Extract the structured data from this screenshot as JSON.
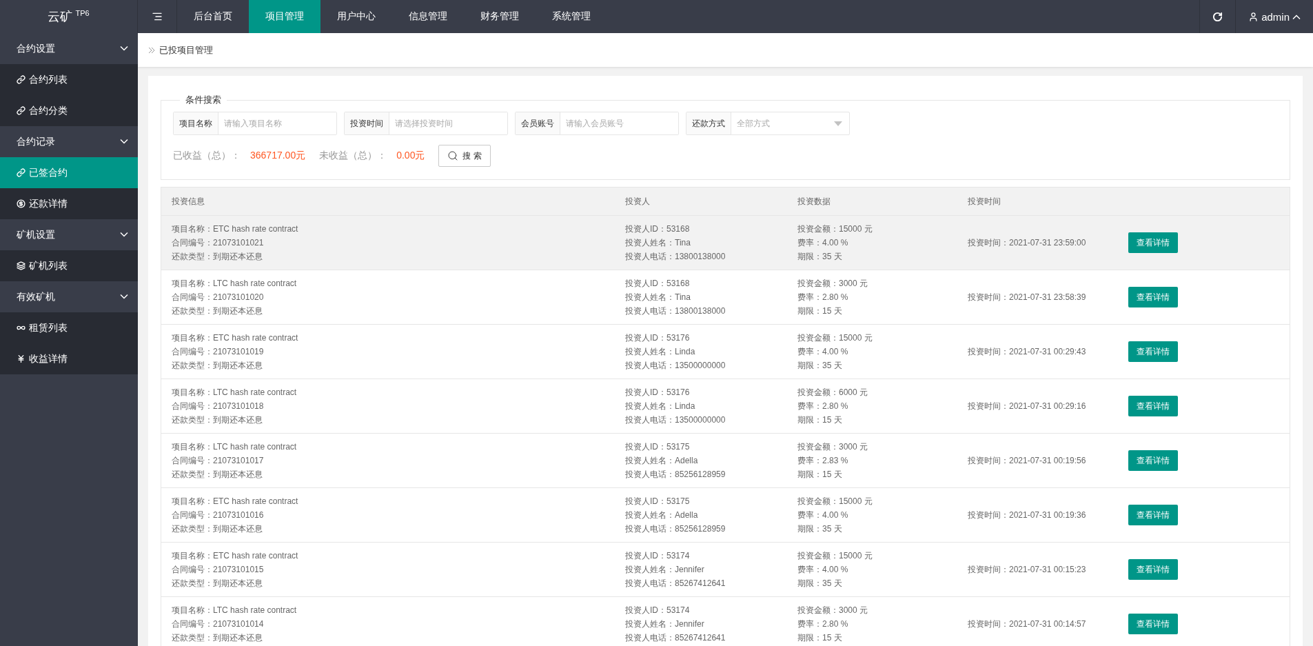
{
  "logo": {
    "name": "云矿",
    "sup": "TP6"
  },
  "nav": [
    {
      "label": "后台首页",
      "selected": false
    },
    {
      "label": "项目管理",
      "selected": true
    },
    {
      "label": "用户中心",
      "selected": false
    },
    {
      "label": "信息管理",
      "selected": false
    },
    {
      "label": "财务管理",
      "selected": false
    },
    {
      "label": "系统管理",
      "selected": false
    }
  ],
  "user": {
    "name": "admin"
  },
  "sidebar": [
    {
      "label": "合约设置",
      "expanded": true,
      "children": [
        {
          "label": "合约列表",
          "selected": false
        },
        {
          "label": "合约分类",
          "selected": false
        }
      ]
    },
    {
      "label": "合约记录",
      "expanded": true,
      "children": [
        {
          "label": "已签合约",
          "selected": true
        },
        {
          "label": "还款详情",
          "selected": false
        }
      ]
    },
    {
      "label": "矿机设置",
      "expanded": true,
      "children": [
        {
          "label": "矿机列表",
          "selected": false
        }
      ]
    },
    {
      "label": "有效矿机",
      "expanded": true,
      "children": [
        {
          "label": "租赁列表",
          "selected": false
        },
        {
          "label": "收益详情",
          "selected": false
        }
      ]
    }
  ],
  "breadcrumb": "已投项目管理",
  "search": {
    "legend": "条件搜索",
    "fields": [
      {
        "label": "项目名称",
        "placeholder": "请输入项目名称",
        "kind": "input"
      },
      {
        "label": "投资时间",
        "placeholder": "请选择投资时间",
        "kind": "input"
      },
      {
        "label": "会员账号",
        "placeholder": "请输入会员账号",
        "kind": "input"
      },
      {
        "label": "还款方式",
        "value": "全部方式",
        "kind": "select"
      }
    ],
    "totals": [
      {
        "label": "已收益（总）：",
        "value": "366717.00元"
      },
      {
        "label": "未收益（总）：",
        "value": "0.00元"
      }
    ],
    "button": "搜 索"
  },
  "table": {
    "columns": [
      "投资信息",
      "投资人",
      "投资数据",
      "投资时间"
    ],
    "rows": [
      {
        "hovered": true,
        "info": [
          "项目名称：ETC hash rate contract",
          "合同编号：21073101021",
          "还款类型：到期还本还息"
        ],
        "investor": [
          "投资人ID：53168",
          "投资人姓名：Tina",
          "投资人电话：13800138000"
        ],
        "data": [
          "投资金额：15000 元",
          "费率：4.00 %",
          "期限：35 天"
        ],
        "time": "投资时间：2021-07-31 23:59:00",
        "action": "查看详情"
      },
      {
        "hovered": false,
        "info": [
          "项目名称：LTC hash rate contract",
          "合同编号：21073101020",
          "还款类型：到期还本还息"
        ],
        "investor": [
          "投资人ID：53168",
          "投资人姓名：Tina",
          "投资人电话：13800138000"
        ],
        "data": [
          "投资金额：3000 元",
          "费率：2.80 %",
          "期限：15 天"
        ],
        "time": "投资时间：2021-07-31 23:58:39",
        "action": "查看详情"
      },
      {
        "hovered": false,
        "info": [
          "项目名称：ETC hash rate contract",
          "合同编号：21073101019",
          "还款类型：到期还本还息"
        ],
        "investor": [
          "投资人ID：53176",
          "投资人姓名：Linda",
          "投资人电话：13500000000"
        ],
        "data": [
          "投资金额：15000 元",
          "费率：4.00 %",
          "期限：35 天"
        ],
        "time": "投资时间：2021-07-31 00:29:43",
        "action": "查看详情"
      },
      {
        "hovered": false,
        "info": [
          "项目名称：LTC hash rate contract",
          "合同编号：21073101018",
          "还款类型：到期还本还息"
        ],
        "investor": [
          "投资人ID：53176",
          "投资人姓名：Linda",
          "投资人电话：13500000000"
        ],
        "data": [
          "投资金额：6000 元",
          "费率：2.80 %",
          "期限：15 天"
        ],
        "time": "投资时间：2021-07-31 00:29:16",
        "action": "查看详情"
      },
      {
        "hovered": false,
        "info": [
          "项目名称：LTC hash rate contract",
          "合同编号：21073101017",
          "还款类型：到期还本还息"
        ],
        "investor": [
          "投资人ID：53175",
          "投资人姓名：Adella",
          "投资人电话：85256128959"
        ],
        "data": [
          "投资金额：3000 元",
          "费率：2.83 %",
          "期限：15 天"
        ],
        "time": "投资时间：2021-07-31 00:19:56",
        "action": "查看详情"
      },
      {
        "hovered": false,
        "info": [
          "项目名称：ETC hash rate contract",
          "合同编号：21073101016",
          "还款类型：到期还本还息"
        ],
        "investor": [
          "投资人ID：53175",
          "投资人姓名：Adella",
          "投资人电话：85256128959"
        ],
        "data": [
          "投资金额：15000 元",
          "费率：4.00 %",
          "期限：35 天"
        ],
        "time": "投资时间：2021-07-31 00:19:36",
        "action": "查看详情"
      },
      {
        "hovered": false,
        "info": [
          "项目名称：ETC hash rate contract",
          "合同编号：21073101015",
          "还款类型：到期还本还息"
        ],
        "investor": [
          "投资人ID：53174",
          "投资人姓名：Jennifer",
          "投资人电话：85267412641"
        ],
        "data": [
          "投资金额：15000 元",
          "费率：4.00 %",
          "期限：35 天"
        ],
        "time": "投资时间：2021-07-31 00:15:23",
        "action": "查看详情"
      },
      {
        "hovered": false,
        "info": [
          "项目名称：LTC hash rate contract",
          "合同编号：21073101014",
          "还款类型：到期还本还息"
        ],
        "investor": [
          "投资人ID：53174",
          "投资人姓名：Jennifer",
          "投资人电话：85267412641"
        ],
        "data": [
          "投资金额：3000 元",
          "费率：2.80 %",
          "期限：15 天"
        ],
        "time": "投资时间：2021-07-31 00:14:57",
        "action": "查看详情"
      }
    ]
  }
}
